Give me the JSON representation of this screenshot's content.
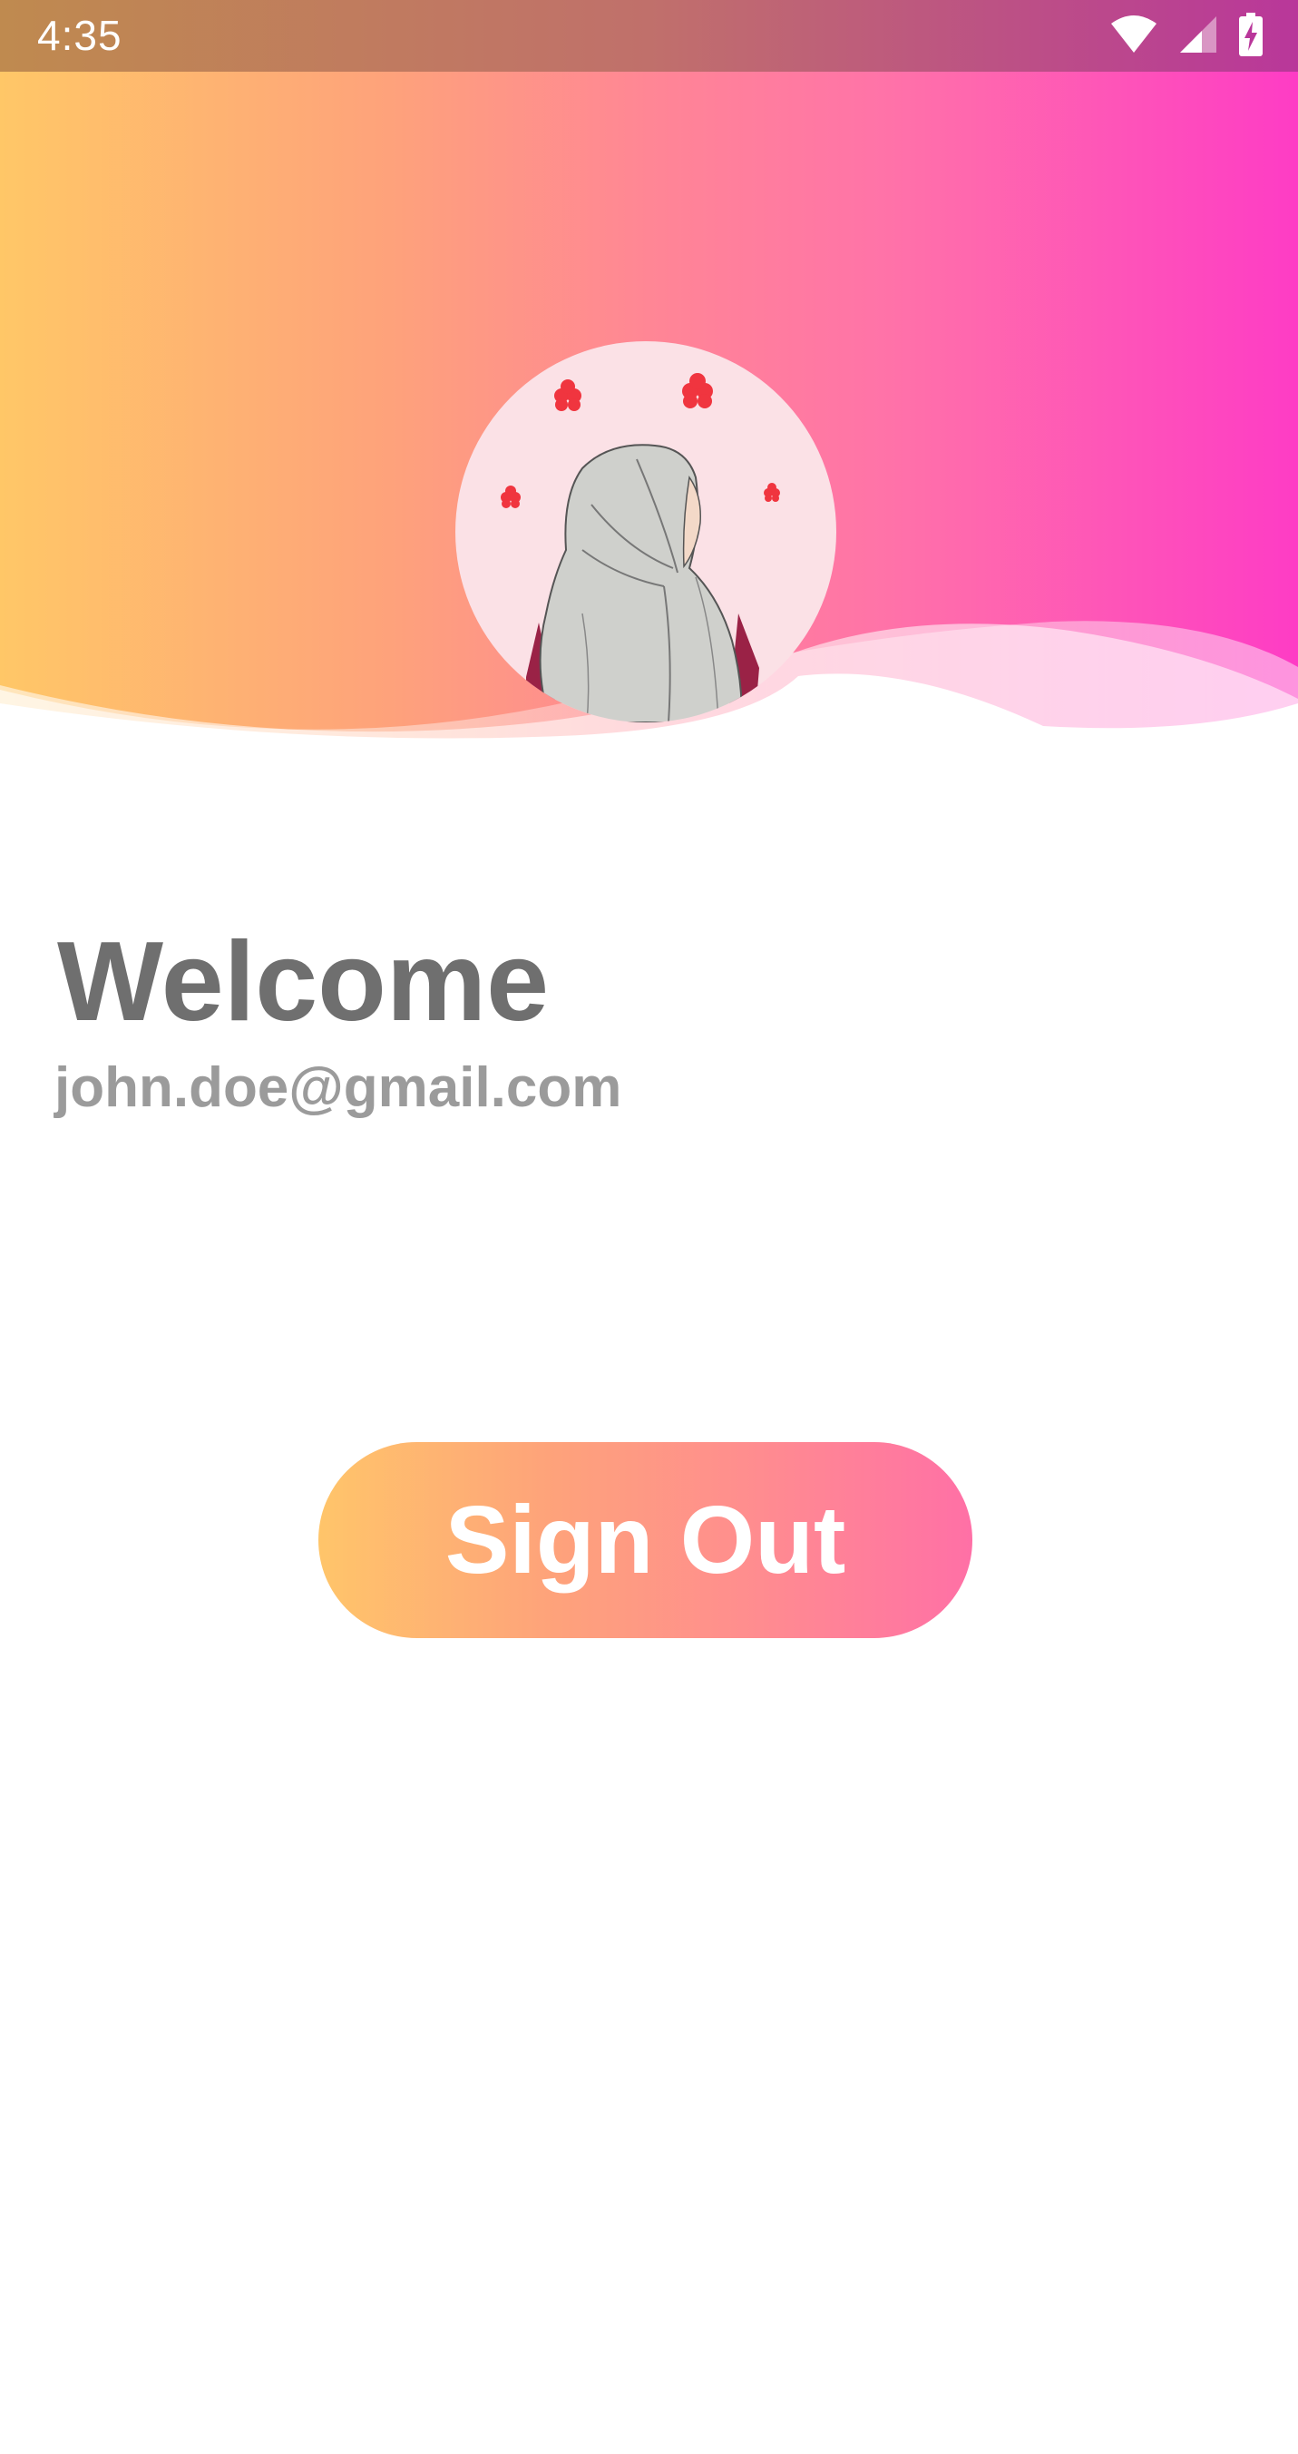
{
  "status_bar": {
    "time": "4:35",
    "icons": [
      "wifi-icon",
      "signal-icon",
      "battery-charging-icon"
    ]
  },
  "header": {
    "gradient_colors": [
      "#ffc767",
      "#ff8695",
      "#fe3cc5"
    ],
    "avatar": "profile-illustration-hijab-woman"
  },
  "profile": {
    "welcome": "Welcome",
    "email": "john.doe@gmail.com"
  },
  "actions": {
    "sign_out_label": "Sign Out",
    "button_colors": [
      "#ffc56a",
      "#ff70a6"
    ]
  }
}
